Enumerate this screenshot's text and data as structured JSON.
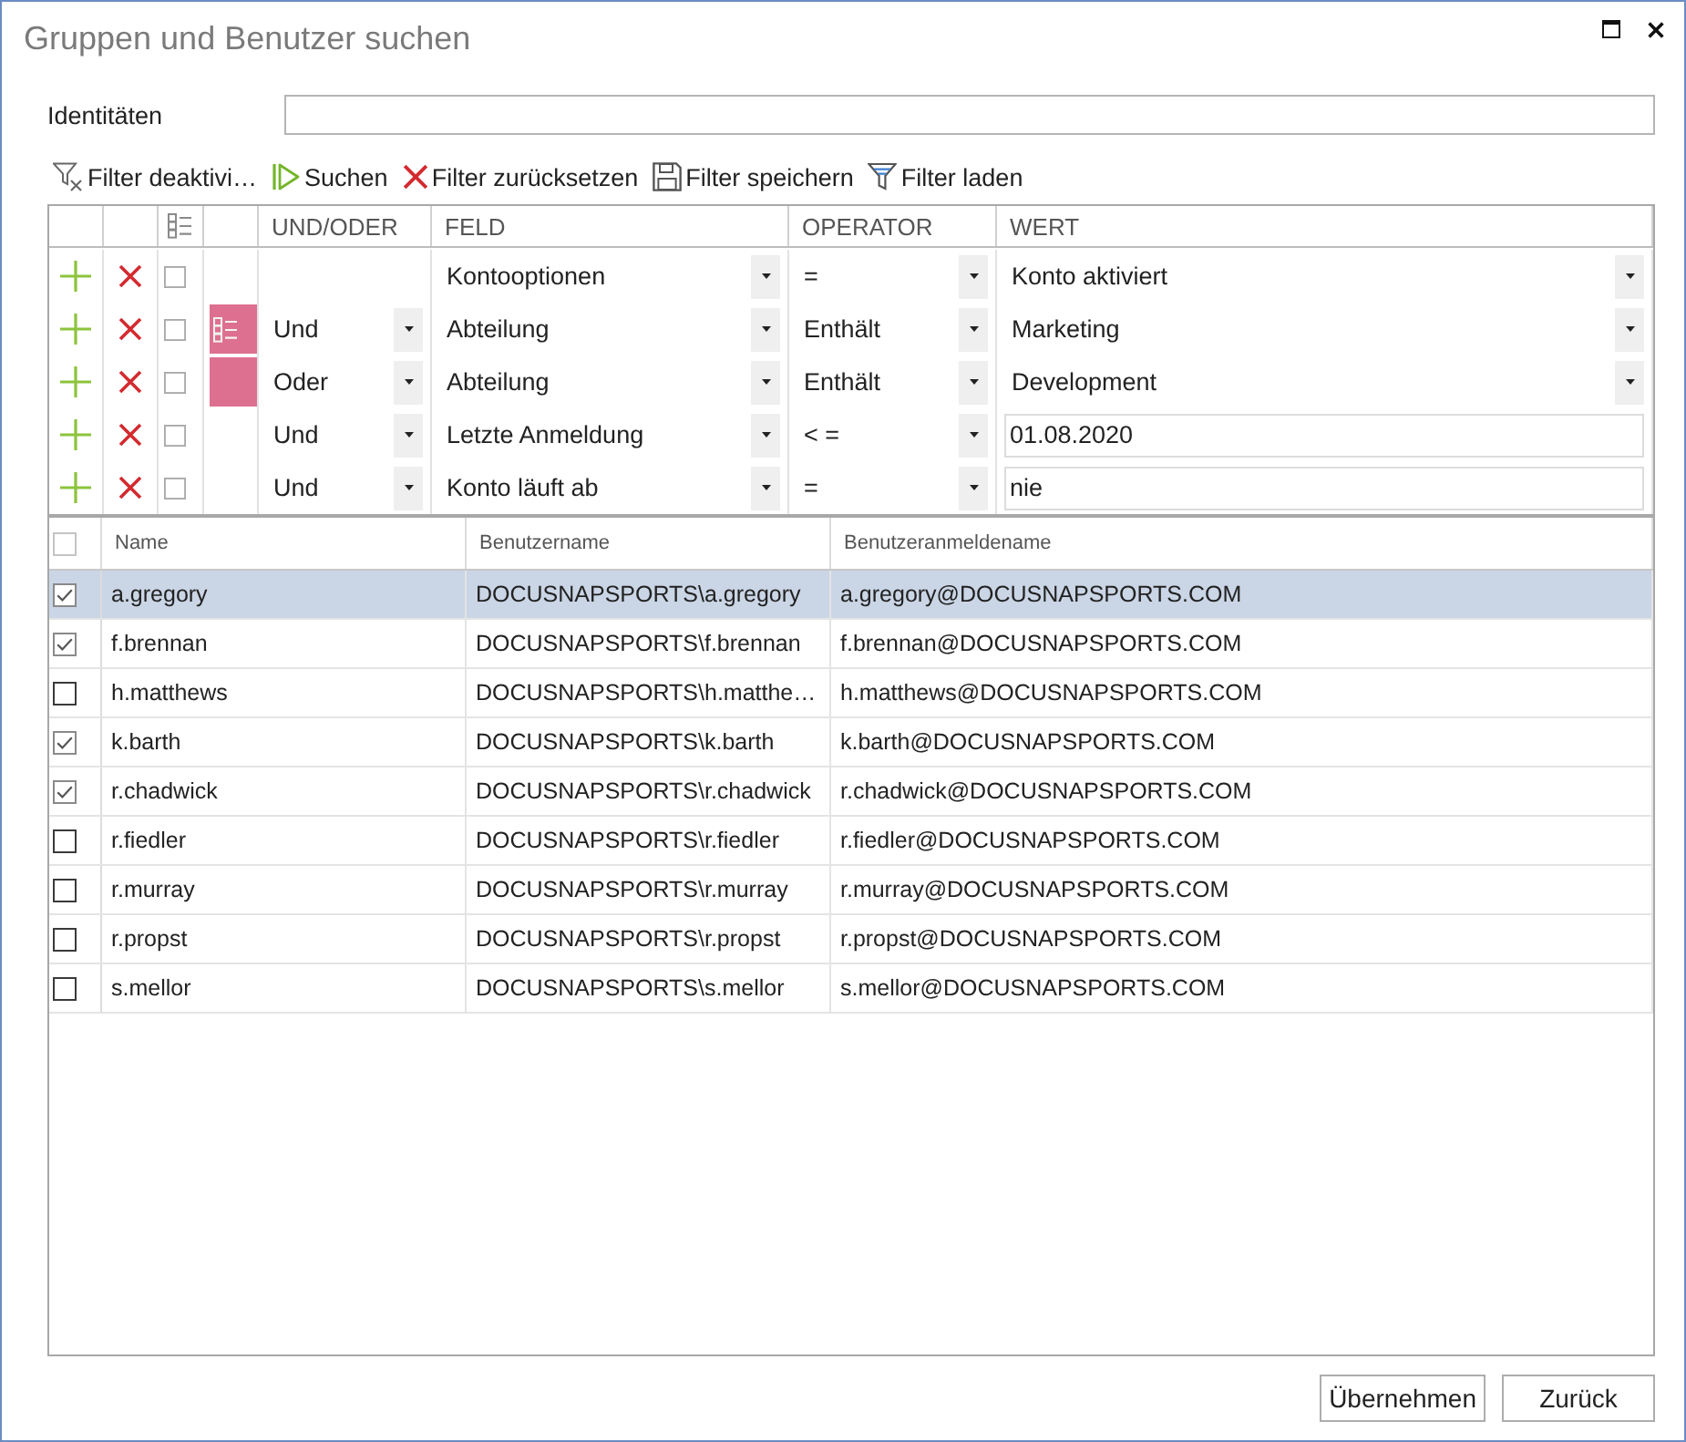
{
  "window": {
    "title": "Gruppen und Benutzer suchen"
  },
  "identities": {
    "label": "Identitäten"
  },
  "toolbar": [
    {
      "kind": "filter_off",
      "label": "Filter deaktivi…"
    },
    {
      "kind": "search",
      "label": "Suchen"
    },
    {
      "kind": "reset",
      "label": "Filter zurücksetzen"
    },
    {
      "kind": "save",
      "label": "Filter speichern"
    },
    {
      "kind": "load",
      "label": "Filter laden"
    }
  ],
  "filter_grid": {
    "columns": [
      "UND/ODER",
      "FELD",
      "OPERATOR",
      "WERT"
    ],
    "rows": [
      {
        "kind": "plain",
        "checked": false,
        "field": "Kontooptionen",
        "operator": "=",
        "value": {
          "kind": "dropdown",
          "text": "Konto aktiviert"
        }
      },
      {
        "kind": "group_start",
        "checked": false,
        "logic": "Und",
        "field": "Abteilung",
        "operator": "Enthält",
        "value": {
          "kind": "dropdown",
          "text": "Marketing"
        }
      },
      {
        "kind": "group_member",
        "checked": false,
        "logic": "Oder",
        "field": "Abteilung",
        "operator": "Enthält",
        "value": {
          "kind": "dropdown",
          "text": "Development"
        }
      },
      {
        "kind": "plain",
        "checked": false,
        "logic": "Und",
        "field": "Letzte Anmeldung",
        "operator": "< =",
        "value": {
          "kind": "input",
          "text": "01.08.2020"
        }
      },
      {
        "kind": "plain",
        "checked": false,
        "logic": "Und",
        "field": "Konto läuft ab",
        "operator": "=",
        "value": {
          "kind": "input",
          "text": "nie"
        }
      }
    ]
  },
  "results": {
    "header_checked": false,
    "columns": [
      "Name",
      "Benutzername",
      "Benutzeranmeldename"
    ],
    "rows": [
      {
        "checked": true,
        "selected": true,
        "name": "a.gregory",
        "username": "DOCUSNAPSPORTS\\a.gregory",
        "login": "a.gregory@DOCUSNAPSPORTS.COM"
      },
      {
        "checked": true,
        "selected": false,
        "name": "f.brennan",
        "username": "DOCUSNAPSPORTS\\f.brennan",
        "login": "f.brennan@DOCUSNAPSPORTS.COM"
      },
      {
        "checked": false,
        "selected": false,
        "name": "h.matthews",
        "username": "DOCUSNAPSPORTS\\h.matthe…",
        "login": "h.matthews@DOCUSNAPSPORTS.COM"
      },
      {
        "checked": true,
        "selected": false,
        "name": "k.barth",
        "username": "DOCUSNAPSPORTS\\k.barth",
        "login": "k.barth@DOCUSNAPSPORTS.COM"
      },
      {
        "checked": true,
        "selected": false,
        "name": "r.chadwick",
        "username": "DOCUSNAPSPORTS\\r.chadwick",
        "login": "r.chadwick@DOCUSNAPSPORTS.COM"
      },
      {
        "checked": false,
        "selected": false,
        "name": "r.fiedler",
        "username": "DOCUSNAPSPORTS\\r.fiedler",
        "login": "r.fiedler@DOCUSNAPSPORTS.COM"
      },
      {
        "checked": false,
        "selected": false,
        "name": "r.murray",
        "username": "DOCUSNAPSPORTS\\r.murray",
        "login": "r.murray@DOCUSNAPSPORTS.COM"
      },
      {
        "checked": false,
        "selected": false,
        "name": "r.propst",
        "username": "DOCUSNAPSPORTS\\r.propst",
        "login": "r.propst@DOCUSNAPSPORTS.COM"
      },
      {
        "checked": false,
        "selected": false,
        "name": "s.mellor",
        "username": "DOCUSNAPSPORTS\\s.mellor",
        "login": "s.mellor@DOCUSNAPSPORTS.COM"
      }
    ]
  },
  "buttons": [
    "Übernehmen",
    "Zurück"
  ]
}
